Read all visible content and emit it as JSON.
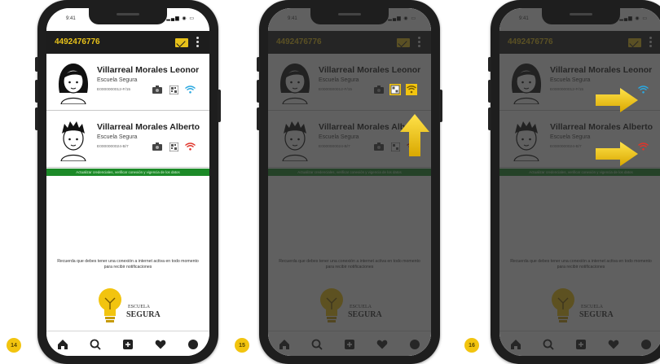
{
  "screens": [
    {
      "step": "14",
      "app_phone": "4492476776",
      "status_time": "9:41",
      "status_icons": "▂▄▆ ◉ ▭",
      "students": [
        {
          "name": "Villarreal Morales Leonor",
          "school": "Escuela Segura",
          "code": "E0000000012-F/15",
          "status_color": "#2aa8e0",
          "status_icon": "wifi-icon"
        },
        {
          "name": "Villarreal Morales Alberto",
          "school": "Escuela Segura",
          "code": "E0000000024-B/7",
          "status_color": "#e0342a",
          "status_icon": "wifi-off-icon"
        }
      ],
      "banner": "Actualizar credenciales, verificar conexión y vigencia de los datos",
      "instructions": "Recuerda que debes tener una conexión a internet activa en todo momento para recibir notificaciones",
      "logo_small": "ESCUELA",
      "logo_big": "SEGURA"
    },
    {
      "step": "15",
      "app_phone": "4492476776",
      "status_time": "9:41",
      "status_icons": "▂▄▆ ◉ ▭",
      "students": [
        {
          "name": "Villarreal Morales Leonor",
          "school": "Escuela Segura",
          "code": "E0000000012-F/15",
          "status_color": "#2aa8e0",
          "status_icon": "wifi-icon"
        },
        {
          "name": "Villarreal Morales Alberto",
          "school": "Escuela Segura",
          "code": "E0000000024-B/7",
          "status_color": "#e0342a",
          "status_icon": "wifi-off-icon"
        }
      ],
      "banner": "Actualizar credenciales, verificar conexión y vigencia de los datos",
      "instructions": "Recuerda que debes tener una conexión a internet activa en todo momento para recibir notificaciones",
      "logo_small": "ESCUELA",
      "logo_big": "SEGURA"
    },
    {
      "step": "16",
      "app_phone": "4492476776",
      "status_time": "9:41",
      "status_icons": "▂▄▆ ◉ ▭",
      "students": [
        {
          "name": "Villarreal Morales Leonor",
          "school": "Escuela Segura",
          "code": "E0000000012-F/15",
          "status_color": "#2aa8e0",
          "status_icon": "wifi-icon"
        },
        {
          "name": "Villarreal Morales Alberto",
          "school": "Escuela Segura",
          "code": "E0000000024-B/7",
          "status_color": "#e0342a",
          "status_icon": "wifi-off-icon"
        }
      ],
      "banner": "Actualizar credenciales, verificar conexión y vigencia de los datos",
      "instructions": "Recuerda que debes tener una conexión a internet activa en todo momento para recibir notificaciones",
      "logo_small": "ESCUELA",
      "logo_big": "SEGURA"
    }
  ],
  "colors": {
    "accent": "#f2c40f",
    "appbar": "#1d1d1d",
    "banner": "#1c8a28",
    "dim_overlay": "#282828"
  },
  "tab_icons": [
    "home-icon",
    "search-icon",
    "plus-square-icon",
    "heart-icon",
    "profile-icon"
  ]
}
